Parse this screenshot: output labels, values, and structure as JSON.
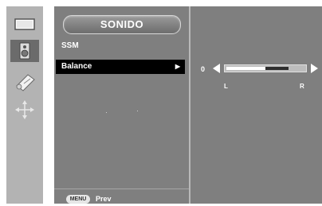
{
  "sidebar": {
    "items": [
      {
        "icon": "picture-icon",
        "active": false
      },
      {
        "icon": "speaker-icon",
        "active": true
      },
      {
        "icon": "clock-tag-icon",
        "active": false
      },
      {
        "icon": "adjust-arrows-icon",
        "active": false
      }
    ]
  },
  "menu": {
    "title": "SONIDO",
    "items": [
      {
        "label": "SSM",
        "selected": false
      },
      {
        "label": "Balance",
        "selected": true,
        "arrow": "▶"
      }
    ]
  },
  "footer": {
    "menu_key": "MENU",
    "prev_label": "Prev"
  },
  "balance": {
    "value": "0",
    "left_label": "L",
    "right_label": "R",
    "level_fraction": 0.5
  },
  "colors": {
    "panel": "#7f7f7f",
    "rail": "#b3b3b3",
    "selected_row": "#000000",
    "text": "#ffffff"
  }
}
